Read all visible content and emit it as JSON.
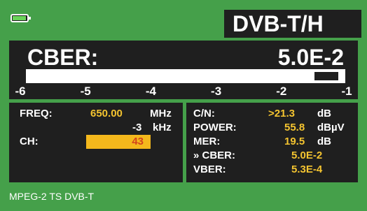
{
  "header": {
    "battery_icon": "battery-icon",
    "title": "DVB-T/H"
  },
  "cber": {
    "label": "CBER:",
    "value": "5.0E-2",
    "scale_ticks": [
      "-6",
      "-5",
      "-4",
      "-3",
      "-2",
      "-1"
    ],
    "indicator_value_log10": -1.3
  },
  "left_panel": {
    "freq_label": "FREQ:",
    "freq_value": "650.00",
    "freq_unit": "MHz",
    "offset_value": "-3",
    "offset_unit": "kHz",
    "ch_label": "CH:",
    "ch_value": "43"
  },
  "right_panel": {
    "cn_label": "C/N:",
    "cn_value": ">21.3",
    "cn_unit": "dB",
    "power_label": "POWER:",
    "power_value": "55.8",
    "power_unit": "dBµV",
    "mer_label": "MER:",
    "mer_value": "19.5",
    "mer_unit": "dB",
    "cber_label": "» CBER:",
    "cber_value": "5.0E-2",
    "vber_label": "VBER:",
    "vber_value": "5.3E-4"
  },
  "status": {
    "text": "MPEG-2 TS DVB-T"
  },
  "colors": {
    "background": "#45a04a",
    "panel": "#1f1f1f",
    "value": "#f4c430",
    "channel_box": "#f4b81c",
    "channel_text": "#d3431c"
  }
}
